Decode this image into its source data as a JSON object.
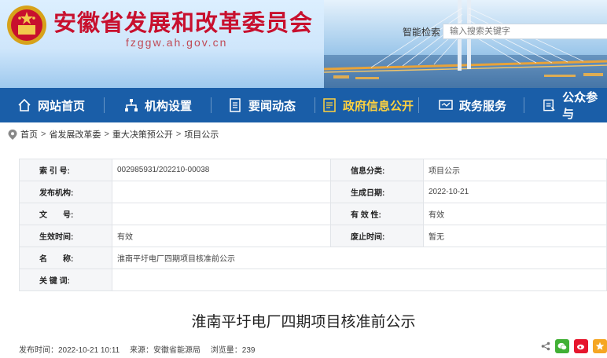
{
  "site": {
    "title": "安徽省发展和改革委员会",
    "domain": "fzggw.ah.gov.cn"
  },
  "search": {
    "label": "智能检索",
    "placeholder": "输入搜索关键字"
  },
  "nav": {
    "items": [
      {
        "label": "网站首页",
        "icon": "home-icon"
      },
      {
        "label": "机构设置",
        "icon": "org-chart-icon"
      },
      {
        "label": "要闻动态",
        "icon": "news-icon"
      },
      {
        "label": "政府信息公开",
        "icon": "info-public-icon",
        "active": true
      },
      {
        "label": "政务服务",
        "icon": "service-icon"
      },
      {
        "label": "公众参与",
        "icon": "participation-icon"
      }
    ]
  },
  "breadcrumb": {
    "items": [
      "首页",
      "省发展改革委",
      "重大决策预公开",
      "项目公示"
    ]
  },
  "info": {
    "rows": [
      {
        "k1": "索 引 号:",
        "v1": "002985931/202210-00038",
        "k2": "信息分类:",
        "v2": "项目公示"
      },
      {
        "k1": "发布机构:",
        "v1": "",
        "k2": "生成日期:",
        "v2": "2022-10-21"
      },
      {
        "k1": "文　　号:",
        "v1": "",
        "k2": "有 效 性:",
        "v2": "有效"
      },
      {
        "k1": "生效时间:",
        "v1": "有效",
        "k2": "废止时间:",
        "v2": "暂无"
      },
      {
        "k1": "名　　称:",
        "v1": "淮南平圩电厂四期项目核准前公示"
      },
      {
        "k1": "关 键 词:",
        "v1": ""
      }
    ]
  },
  "article": {
    "title": "淮南平圩电厂四期项目核准前公示",
    "meta_time": "发布时间：2022-10-21 10:11",
    "meta_source": "来源：安徽省能源局",
    "meta_views": "浏览量：239"
  },
  "colors": {
    "nav_bg": "#1a5ea8",
    "nav_active": "#ffd23f",
    "title_red": "#c8102e"
  }
}
